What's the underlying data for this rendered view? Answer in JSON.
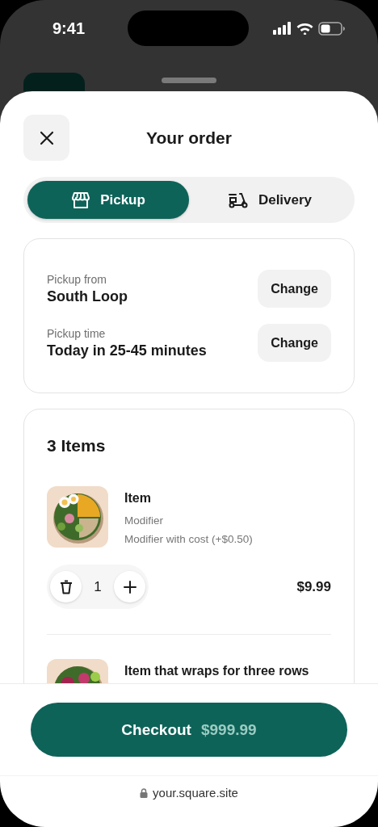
{
  "status_bar": {
    "time": "9:41"
  },
  "sheet": {
    "title": "Your order"
  },
  "tabs": [
    {
      "label": "Pickup",
      "selected": true
    },
    {
      "label": "Delivery",
      "selected": false
    }
  ],
  "pickup_details": [
    {
      "label": "Pickup from",
      "value": "South Loop",
      "button": "Change"
    },
    {
      "label": "Pickup time",
      "value": "Today in 25-45 minutes",
      "button": "Change"
    }
  ],
  "items_heading": "3 Items",
  "items": [
    {
      "name": "Item",
      "modifiers": [
        "Modifier",
        "Modifier with cost (+$0.50)"
      ],
      "quantity": "1",
      "price": "$9.99"
    },
    {
      "name": "Item that wraps for three rows"
    }
  ],
  "checkout": {
    "label": "Checkout",
    "total": "$999.99"
  },
  "address_bar": {
    "url": "your.square.site"
  }
}
